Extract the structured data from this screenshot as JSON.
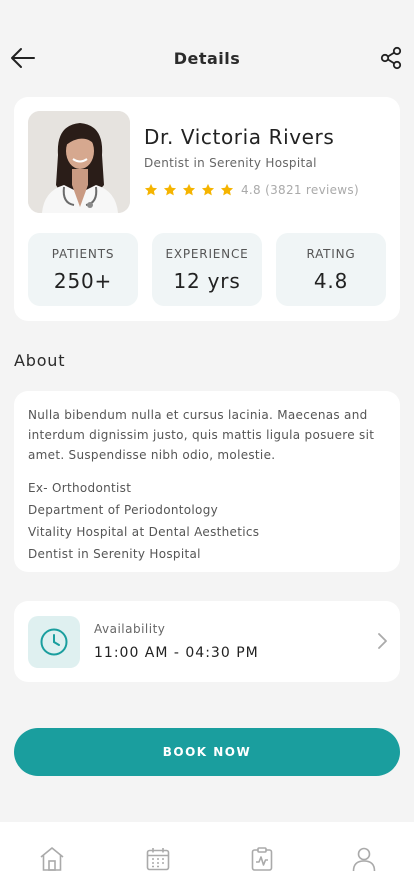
{
  "header": {
    "title": "Details",
    "back_icon": "arrow-left-icon",
    "share_icon": "share-icon"
  },
  "doctor": {
    "name": "Dr. Victoria Rivers",
    "role": "Dentist in Serenity Hospital",
    "rating_stars": 5,
    "rating_text": "4.8 (3821 reviews)"
  },
  "stats": [
    {
      "label": "PATIENTS",
      "value": "250+"
    },
    {
      "label": "EXPERIENCE",
      "value": "12 yrs"
    },
    {
      "label": "RATING",
      "value": "4.8"
    }
  ],
  "about": {
    "title": "About",
    "text": "Nulla bibendum nulla et cursus lacinia. Maecenas and interdum dignissim justo, quis mattis ligula posuere sit amet. Suspendisse nibh odio, molestie.",
    "items": [
      "Ex- Orthodontist",
      "Department of Periodontology",
      "Vitality Hospital at Dental Aesthetics",
      "Dentist in Serenity Hospital"
    ]
  },
  "availability": {
    "label": "Availability",
    "time": "11:00 AM - 04:30 PM"
  },
  "book_button": "BOOK NOW",
  "colors": {
    "accent": "#1a9e9e",
    "star": "#f5b400"
  },
  "tabbar": {
    "icons": [
      "home-icon",
      "calendar-icon",
      "clipboard-icon",
      "profile-icon"
    ]
  }
}
